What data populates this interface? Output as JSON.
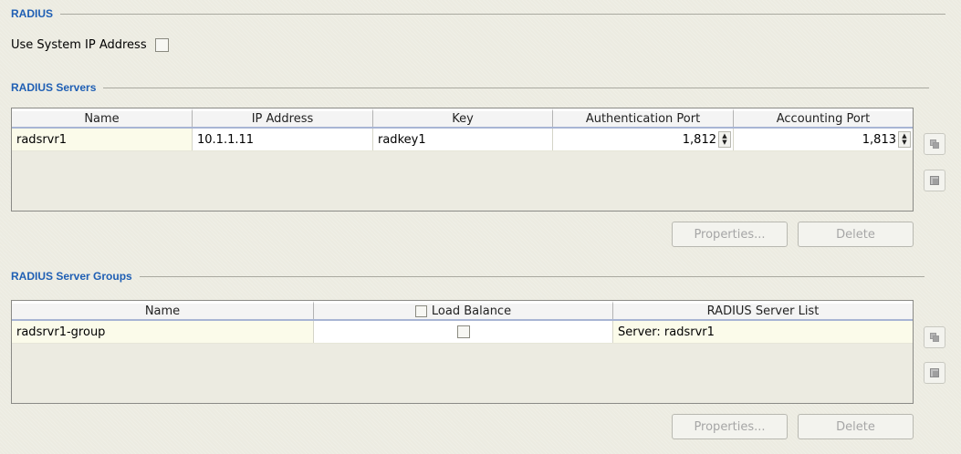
{
  "radius": {
    "title": "RADIUS",
    "use_system_ip_label": "Use System IP Address",
    "use_system_ip_checked": false
  },
  "servers": {
    "title": "RADIUS Servers",
    "columns": [
      "Name",
      "IP Address",
      "Key",
      "Authentication Port",
      "Accounting Port"
    ],
    "rows": [
      {
        "name": "radsrvr1",
        "ip": "10.1.1.11",
        "key": "radkey1",
        "auth_port": "1,812",
        "acct_port": "1,813"
      }
    ],
    "properties_label": "Properties...",
    "delete_label": "Delete"
  },
  "groups": {
    "title": "RADIUS Server Groups",
    "columns": [
      "Name",
      "Load Balance",
      "RADIUS Server List"
    ],
    "rows": [
      {
        "name": "radsrvr1-group",
        "load_balance": false,
        "server_list": "Server: radsrvr1"
      }
    ],
    "properties_label": "Properties...",
    "delete_label": "Delete"
  }
}
